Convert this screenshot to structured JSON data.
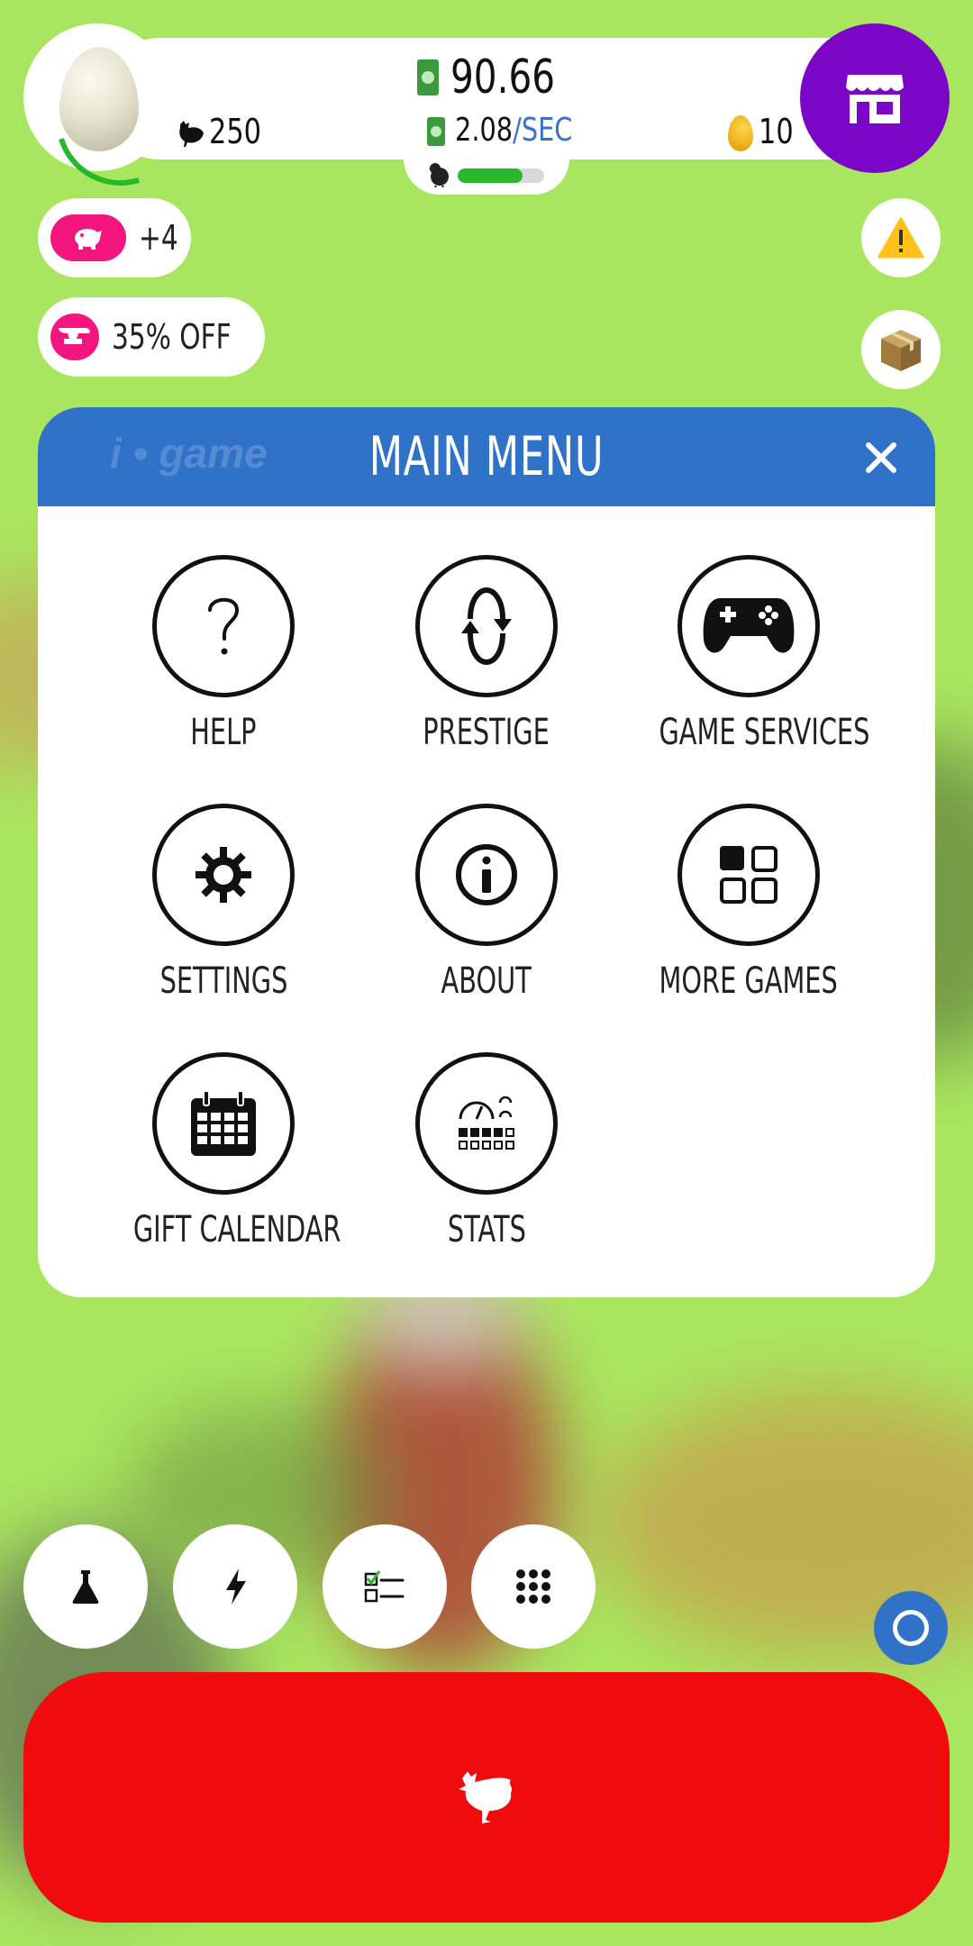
{
  "hud": {
    "money": "90.66",
    "money_rate_value": "2.08",
    "money_rate_unit": "/SEC",
    "chickens": "250",
    "golden_eggs": "10",
    "hatch_progress": 0.75
  },
  "pills": [
    {
      "icon": "piggy-bank-icon",
      "text": "+4"
    },
    {
      "icon": "anvil-icon",
      "text": "35% OFF"
    }
  ],
  "modal": {
    "title": "MAIN MENU",
    "watermark": "game",
    "items": [
      {
        "icon": "question-icon",
        "label": "HELP"
      },
      {
        "icon": "prestige-icon",
        "label": "PRESTIGE"
      },
      {
        "icon": "gamepad-icon",
        "label": "GAME SERVICES"
      },
      {
        "icon": "gear-icon",
        "label": "SETTINGS"
      },
      {
        "icon": "info-icon",
        "label": "ABOUT"
      },
      {
        "icon": "grid-icon",
        "label": "MORE GAMES"
      },
      {
        "icon": "calendar-icon",
        "label": "GIFT CALENDAR"
      },
      {
        "icon": "gauge-icon",
        "label": "STATS"
      }
    ]
  },
  "colors": {
    "background": "#a9e65f",
    "shop": "#7b06c8",
    "header": "#2f72c8",
    "hatch": "#f00c0c",
    "badge": "#f5157f",
    "progress": "#27b82b"
  }
}
